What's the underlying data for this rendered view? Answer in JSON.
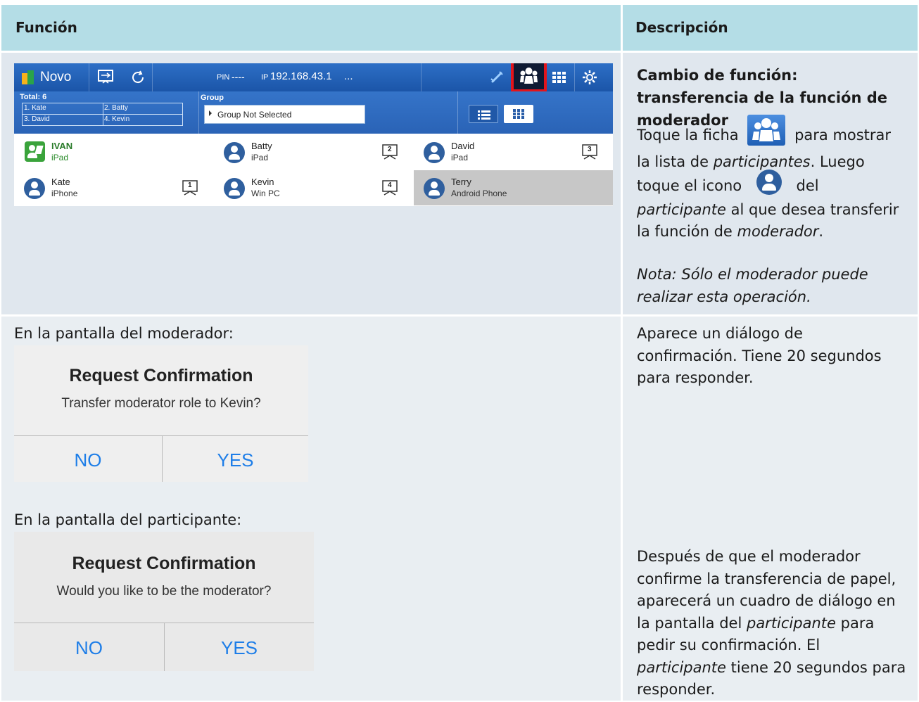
{
  "header": {
    "col1": "Función",
    "col2": "Descripción"
  },
  "novo": {
    "app_name": "Novo",
    "pin_label": "PIN",
    "pin_value": "----",
    "ip_label": "IP",
    "ip_value": "192.168.43.1",
    "ellipsis": "...",
    "total_label": "Total: 6",
    "roster": [
      "1. Kate",
      "2. Batty",
      "3. David",
      "4. Kevin"
    ],
    "group_label": "Group",
    "group_value": "Group Not Selected",
    "participants": [
      {
        "name": "IVAN",
        "device": "iPad",
        "badge": ""
      },
      {
        "name": "Batty",
        "device": "iPad",
        "badge": "2"
      },
      {
        "name": "David",
        "device": "iPad",
        "badge": "3"
      },
      {
        "name": "Kate",
        "device": "iPhone",
        "badge": "1"
      },
      {
        "name": "Kevin",
        "device": "Win PC",
        "badge": "4"
      },
      {
        "name": "Terry",
        "device": "Android Phone",
        "badge": ""
      }
    ],
    "colors": {
      "bar": "#1b55a8",
      "highlight": "#e3141b",
      "moderator_green": "#3aa33b"
    }
  },
  "row1": {
    "title": "Cambio de función: transferencia de la función de moderador",
    "p1_a": "Toque la ficha",
    "p1_b": "para mostrar la lista de",
    "p1_c": "participantes",
    "p1_d": ". Luego toque el icono",
    "p1_e": "del",
    "p1_f": "participante",
    "p1_g": "al que desea transferir la función de",
    "p1_h": "moderador",
    "p1_i": ".",
    "note": "Nota: Sólo el moderador puede realizar esta operación."
  },
  "row2": {
    "moderator_caption": "En la pantalla del moderador:",
    "dialog1": {
      "title": "Request Confirmation",
      "message": "Transfer moderator role to Kevin?",
      "no": "NO",
      "yes": "YES"
    },
    "participant_caption": "En la pantalla del participante:",
    "dialog2": {
      "title": "Request Confirmation",
      "message": "Would you like to be the moderator?",
      "no": "NO",
      "yes": "YES"
    },
    "desc1": "Aparece un diálogo de confirmación. Tiene 20 segundos para responder.",
    "desc2_a": "Después de que el moderador confirme la transferencia de papel, aparecerá un cuadro de diálogo en la pantalla del",
    "desc2_b": "participante",
    "desc2_c": "para pedir su confirmación. El",
    "desc2_d": "participante",
    "desc2_e": "tiene 20 segundos para responder."
  }
}
